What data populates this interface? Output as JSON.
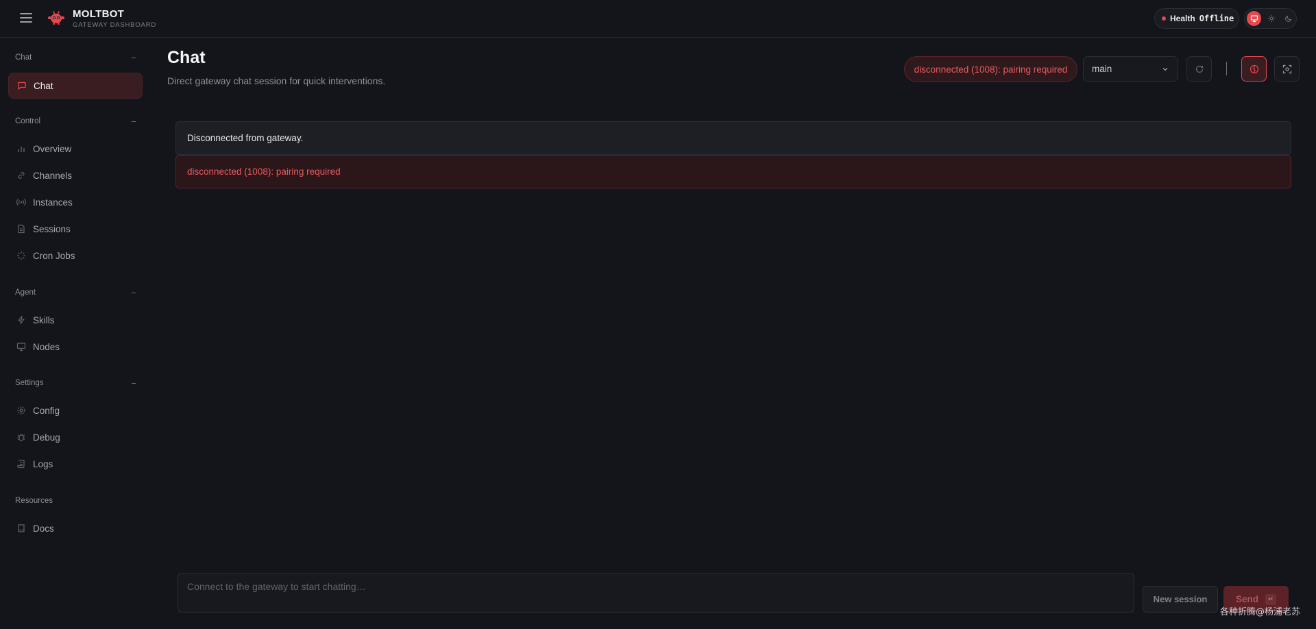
{
  "app": {
    "brand_title": "MOLTBOT",
    "brand_subtitle": "GATEWAY DASHBOARD",
    "accent_color": "#e5484d"
  },
  "header": {
    "health_label": "Health",
    "health_value": "Offline",
    "theme_options": [
      "monitor-icon",
      "sun-icon",
      "moon-icon"
    ],
    "active_theme": "monitor-icon"
  },
  "sidebar": {
    "sections": [
      {
        "title": "Chat",
        "items": [
          {
            "label": "Chat",
            "icon": "message-square-icon",
            "active": true
          }
        ]
      },
      {
        "title": "Control",
        "items": [
          {
            "label": "Overview",
            "icon": "bar-chart-icon"
          },
          {
            "label": "Channels",
            "icon": "link-icon"
          },
          {
            "label": "Instances",
            "icon": "radio-icon"
          },
          {
            "label": "Sessions",
            "icon": "file-text-icon"
          },
          {
            "label": "Cron Jobs",
            "icon": "loader-icon"
          }
        ]
      },
      {
        "title": "Agent",
        "items": [
          {
            "label": "Skills",
            "icon": "zap-icon"
          },
          {
            "label": "Nodes",
            "icon": "monitor-icon"
          }
        ]
      },
      {
        "title": "Settings",
        "items": [
          {
            "label": "Config",
            "icon": "settings-icon"
          },
          {
            "label": "Debug",
            "icon": "bug-icon"
          },
          {
            "label": "Logs",
            "icon": "scroll-icon"
          }
        ]
      },
      {
        "title": "Resources",
        "items": [
          {
            "label": "Docs",
            "icon": "book-icon"
          }
        ]
      }
    ]
  },
  "main": {
    "title": "Chat",
    "subtitle": "Direct gateway chat session for quick interventions.",
    "status": "disconnected (1008): pairing required",
    "session_selected": "main",
    "messages": [
      {
        "type": "info",
        "text": "Disconnected from gateway."
      },
      {
        "type": "error",
        "text": "disconnected (1008): pairing required"
      }
    ],
    "composer_placeholder": "Connect to the gateway to start chatting…",
    "new_session_label": "New session",
    "send_label": "Send",
    "send_shortcut": "↵"
  },
  "watermark": "各种折腾@杨浦老苏"
}
